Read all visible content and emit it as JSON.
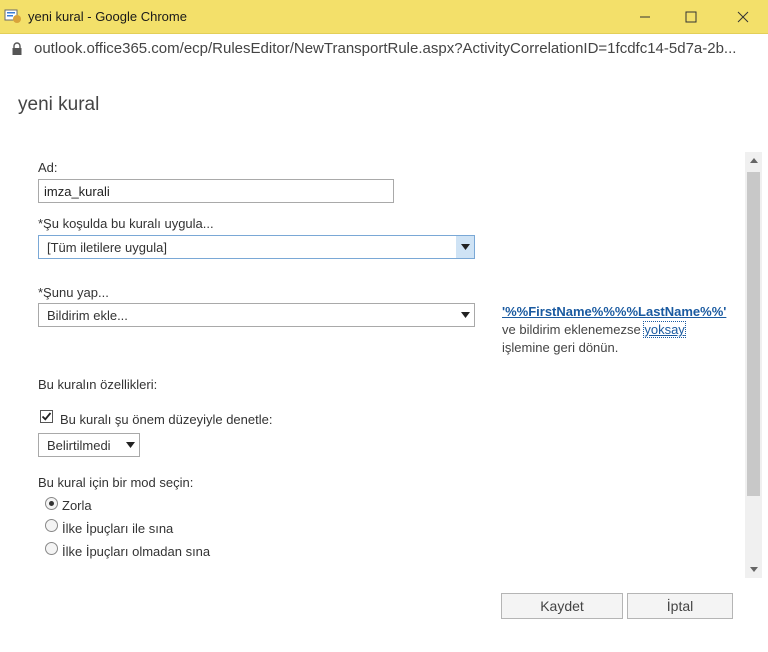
{
  "window": {
    "title": "yeni kural - Google Chrome",
    "url": "outlook.office365.com/ecp/RulesEditor/NewTransportRule.aspx?ActivityCorrelationID=1fcdfc14-5d7a-2b..."
  },
  "page": {
    "title": "yeni kural"
  },
  "form": {
    "name_label": "Ad:",
    "name_value": "imza_kurali",
    "condition_label": "*Şu koşulda bu kuralı uygula...",
    "condition_value": "[Tüm iletilere uygula]",
    "action_label": "*Şunu yap...",
    "action_value": "Bildirim ekle...",
    "action_info": {
      "link": "'%%FirstName%%%%LastName%%'",
      "text1": " ve bildirim eklenemezse ",
      "link2": "yoksay",
      "text2": " işlemine geri dönün."
    },
    "properties_label": "Bu kuralın özellikleri:",
    "audit_checkbox_label": "Bu kuralı şu önem düzeyiyle denetle:",
    "audit_checked": true,
    "severity_value": "Belirtilmedi",
    "mode_label": "Bu kural için bir mod seçin:",
    "modes": [
      {
        "label": "Zorla",
        "checked": true
      },
      {
        "label": "İlke İpuçları ile sına",
        "checked": false
      },
      {
        "label": "İlke İpuçları olmadan sına",
        "checked": false
      }
    ]
  },
  "buttons": {
    "save": "Kaydet",
    "cancel": "İptal"
  },
  "colors": {
    "titlebar": "#f3e06a",
    "link": "#1a5aa0"
  }
}
